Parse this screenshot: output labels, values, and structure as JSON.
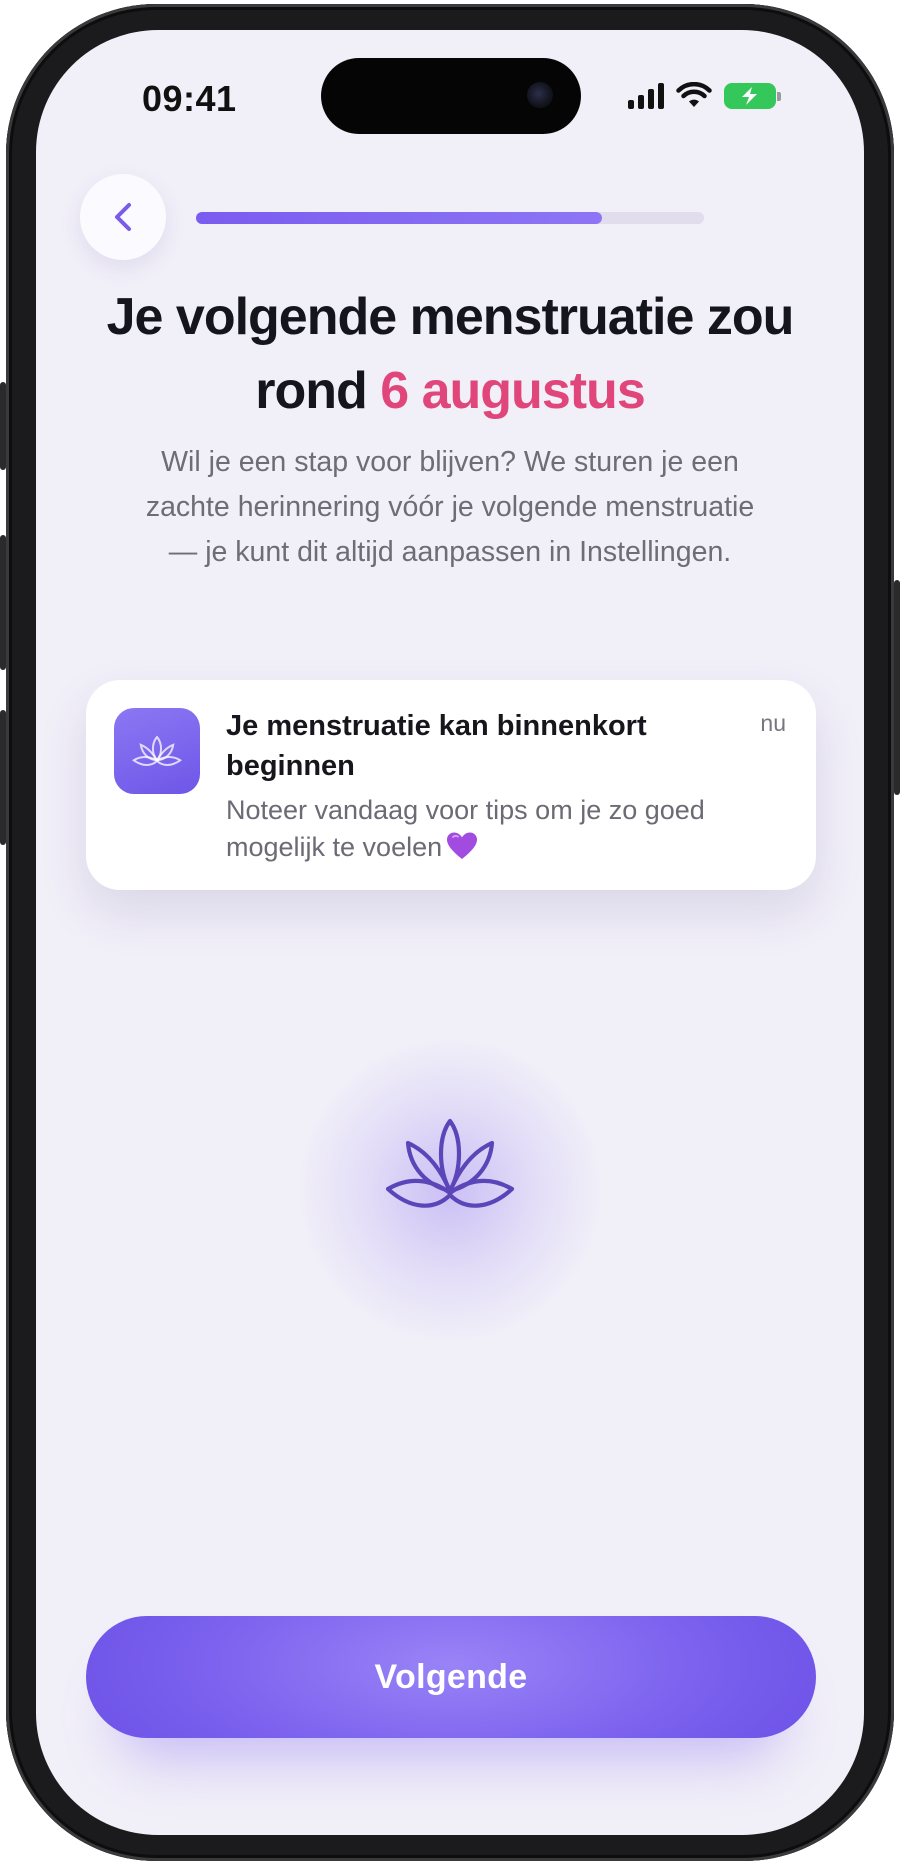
{
  "status_bar": {
    "time": "09:41"
  },
  "header": {
    "progress": 0.8
  },
  "main": {
    "title_prefix": "Je volgende menstruatie zou rond ",
    "title_highlight": "6 augustus",
    "subtitle": "Wil je een stap voor blijven? We sturen je een zachte herinnering vóór je volgende menstruatie — je kunt dit altijd aanpassen in Instellingen."
  },
  "notification": {
    "title": "Je menstruatie kan binnenkort beginnen",
    "time": "nu",
    "body": "Noteer vandaag voor tips om je zo goed mogelijk te voelen"
  },
  "footer": {
    "next_label": "Volgende"
  },
  "colors": {
    "accent": "#7c62ee",
    "highlight": "#e0467a",
    "background": "#f1eff8"
  },
  "icons": [
    "back-chevron-icon",
    "lotus-icon",
    "purple-heart-icon",
    "signal-icon",
    "wifi-icon",
    "battery-charging-icon"
  ]
}
